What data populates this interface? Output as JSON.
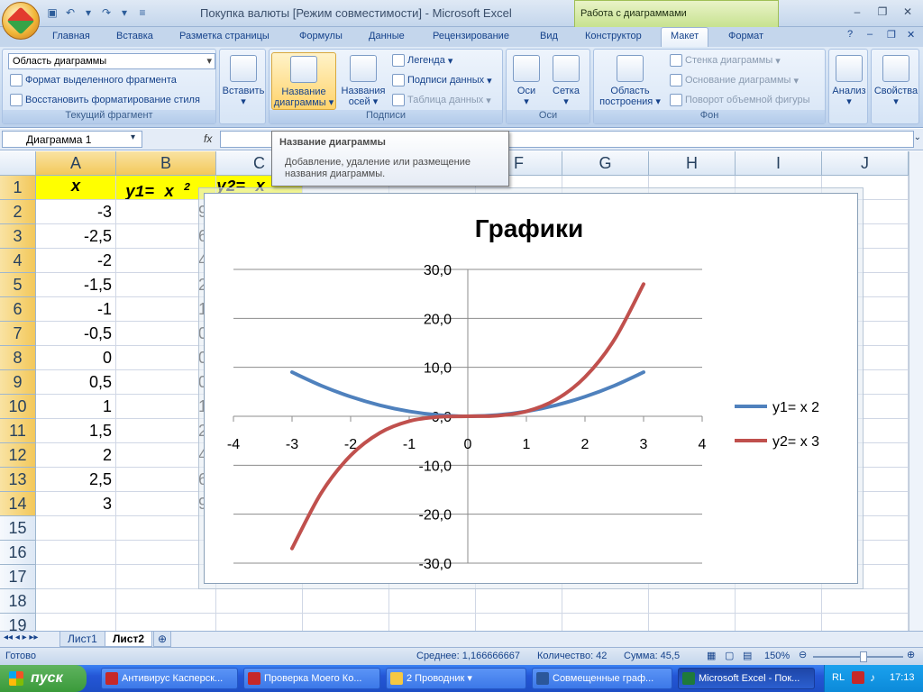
{
  "window": {
    "title": "Покупка валюты  [Режим совместимости] - Microsoft Excel",
    "context_title": "Работа с диаграммами"
  },
  "tabs": [
    "Главная",
    "Вставка",
    "Разметка страницы",
    "Формулы",
    "Данные",
    "Рецензирование",
    "Вид",
    "Конструктор",
    "Макет",
    "Формат"
  ],
  "ribbon": {
    "current_fragment": {
      "selector_value": "Область диаграммы",
      "format_selection": "Формат выделенного фрагмента",
      "reset_style": "Восстановить форматирование стиля",
      "label": "Текущий фрагмент"
    },
    "insert_label": "Вставить",
    "labels_group": {
      "chart_title_line1": "Название",
      "chart_title_line2": "диаграммы",
      "axis_titles_line1": "Названия",
      "axis_titles_line2": "осей",
      "legend": "Легенда",
      "data_labels": "Подписи данных",
      "data_table": "Таблица данных",
      "label": "Подписи"
    },
    "axes_group": {
      "axes": "Оси",
      "grid": "Сетка",
      "label": "Оси"
    },
    "background_group": {
      "plot_area_line1": "Область",
      "plot_area_line2": "построения",
      "chart_wall": "Стенка диаграммы",
      "chart_floor": "Основание диаграммы",
      "rotation": "Поворот объемной фигуры",
      "label": "Фон"
    },
    "analysis": "Анализ",
    "properties": "Свойства"
  },
  "formula_bar": {
    "name_box": "Диаграмма 1",
    "fx": "fx",
    "content": ""
  },
  "tooltip": {
    "title": "Название диаграммы",
    "description": "Добавление, удаление или размещение названия диаграммы."
  },
  "sheet": {
    "columns": [
      "A",
      "B",
      "C",
      "D",
      "E",
      "F",
      "G",
      "H",
      "I",
      "J"
    ],
    "rows": [
      "1",
      "2",
      "3",
      "4",
      "5",
      "6",
      "7",
      "8",
      "9",
      "10",
      "11",
      "12",
      "13",
      "14",
      "15",
      "16",
      "17",
      "18",
      "19"
    ],
    "header_a": "x",
    "header_b": "y1= x ",
    "header_b_sup": "2",
    "header_c": "y2= x",
    "col_a": [
      "-3",
      "-2,5",
      "-2",
      "-1,5",
      "-1",
      "-0,5",
      "0",
      "0,5",
      "1",
      "1,5",
      "2",
      "2,5",
      "3"
    ],
    "col_b": [
      "9,",
      "6,",
      "4,",
      "2,",
      "1,",
      "0,",
      "0,",
      "0,",
      "1,",
      "2,",
      "4,",
      "6,",
      "9,"
    ]
  },
  "chart_data": {
    "type": "line",
    "title": "Графики",
    "x": [
      -3,
      -2.5,
      -2,
      -1.5,
      -1,
      -0.5,
      0,
      0.5,
      1,
      1.5,
      2,
      2.5,
      3
    ],
    "series": [
      {
        "name": "y1= x 2",
        "color": "#4f81bd",
        "values": [
          9,
          6.25,
          4,
          2.25,
          1,
          0.25,
          0,
          0.25,
          1,
          2.25,
          4,
          6.25,
          9
        ]
      },
      {
        "name": "y2= x 3",
        "color": "#c0504d",
        "values": [
          -27,
          -15.625,
          -8,
          -3.375,
          -1,
          -0.125,
          0,
          0.125,
          1,
          3.375,
          8,
          15.625,
          27
        ]
      }
    ],
    "xlim": [
      -4,
      4
    ],
    "ylim": [
      -30,
      30
    ],
    "x_ticks": [
      "-4",
      "-3",
      "-2",
      "-1",
      "0",
      "1",
      "2",
      "3",
      "4"
    ],
    "y_ticks": [
      "30,0",
      "20,0",
      "10,0",
      "0,0",
      "-10,0",
      "-20,0",
      "-30,0"
    ],
    "grid": true,
    "legend_position": "right"
  },
  "sheet_tabs": [
    "Лист1",
    "Лист2"
  ],
  "status": {
    "ready": "Готово",
    "average": "Среднее: 1,166666667",
    "count": "Количество: 42",
    "sum": "Сумма: 45,5",
    "zoom": "150%"
  },
  "taskbar": {
    "start": "пуск",
    "items": [
      "Антивирус Касперск...",
      "Проверка Моего Ко...",
      "2 Проводник",
      "Совмещенные граф...",
      "Microsoft Excel - Пок..."
    ],
    "lang": "RL",
    "time": "17:13"
  }
}
